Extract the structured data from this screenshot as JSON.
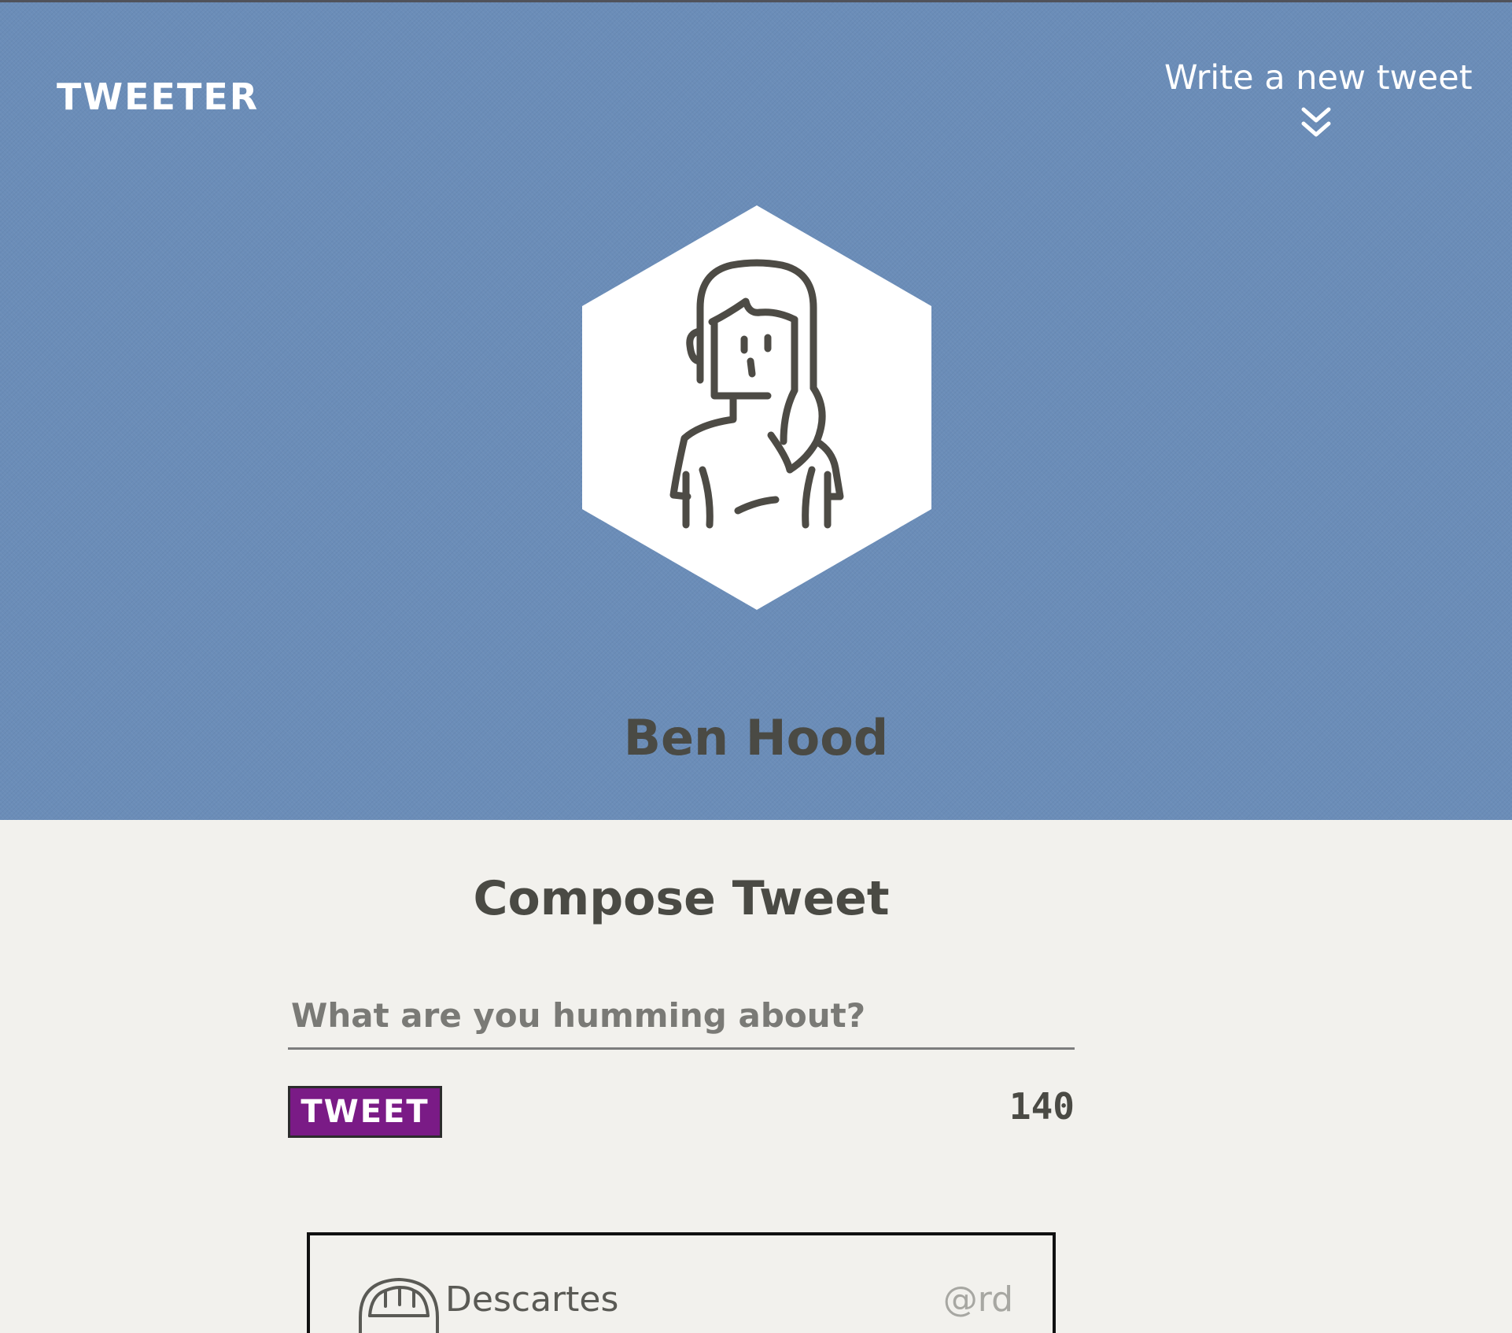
{
  "header": {
    "logo": "TWEETER",
    "write_new_label": "Write a new tweet",
    "write_new_icon": "double-chevron-down-icon"
  },
  "profile": {
    "avatar_icon": "woman-avatar-icon",
    "name": "Ben Hood"
  },
  "compose": {
    "title": "Compose Tweet",
    "input_value": "",
    "input_placeholder": "What are you humming about?",
    "button_label": "TWEET",
    "char_count": "140"
  },
  "tweets": [
    {
      "author": "Descartes",
      "handle": "@rd",
      "avatar_icon": "avatar-icon"
    }
  ],
  "colors": {
    "hero_background": "#6b8db8",
    "page_background": "#f2f1ed",
    "accent_button": "#7a1b86",
    "text_dark": "#4a4a44"
  }
}
